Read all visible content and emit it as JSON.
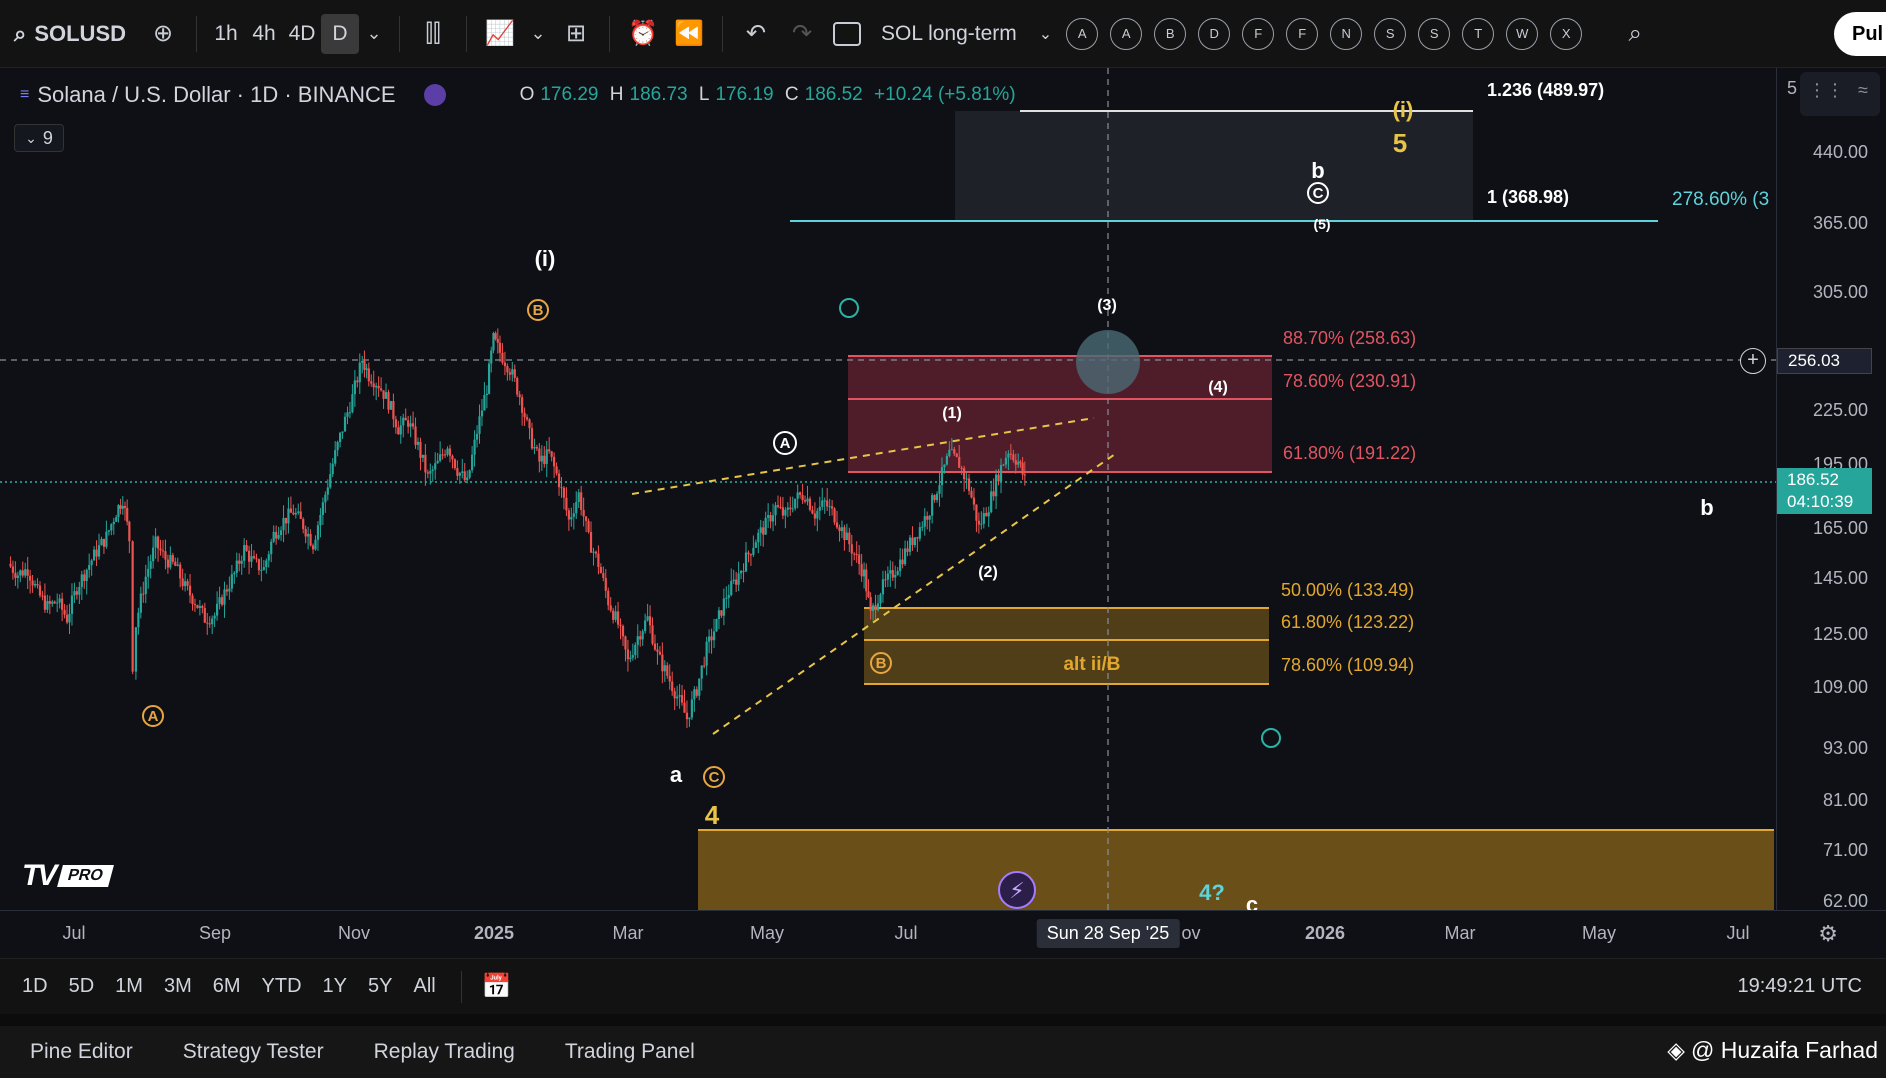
{
  "toolbar": {
    "symbol": "SOLUSD",
    "intervals": [
      "1h",
      "4h",
      "4D",
      "D"
    ],
    "active_interval": "D",
    "layout_name": "SOL long-term",
    "alert_circles": [
      "A",
      "A",
      "B",
      "D",
      "F",
      "F",
      "N",
      "S",
      "S",
      "T",
      "W",
      "X"
    ],
    "publish_label": "Pul"
  },
  "legend": {
    "title": "Solana / U.S. Dollar · 1D · BINANCE",
    "o_key": "O",
    "o_val": "176.29",
    "h_key": "H",
    "h_val": "186.73",
    "l_key": "L",
    "l_val": "176.19",
    "c_key": "C",
    "c_val": "186.52",
    "change": "+10.24 (+5.81%)",
    "collapsed_count": "9"
  },
  "price_axis": {
    "labels": [
      "440.00",
      "365.00",
      "305.00",
      "225.00",
      "195.00",
      "165.00",
      "145.00",
      "125.00",
      "109.00",
      "93.00",
      "81.00",
      "71.00",
      "62.00"
    ],
    "top_partial": "5",
    "crosshair_price": "256.03",
    "last_price": "186.52",
    "countdown": "04:10:39"
  },
  "time_axis": {
    "labels": [
      "Jul",
      "Sep",
      "Nov",
      "2025",
      "Mar",
      "May",
      "Jul",
      "ov",
      "2026",
      "Mar",
      "May",
      "Jul"
    ],
    "cursor_date": "Sun 28 Sep '25"
  },
  "fib_levels": {
    "upper": [
      {
        "label": "1.236 (489.97)"
      },
      {
        "label": "1 (368.98)"
      },
      {
        "label": "278.60% (3"
      }
    ],
    "resistance": [
      {
        "label": "88.70% (258.63)"
      },
      {
        "label": "78.60% (230.91)"
      },
      {
        "label": "61.80% (191.22)"
      }
    ],
    "support": [
      {
        "label": "50.00% (133.49)"
      },
      {
        "label": "61.80% (123.22)"
      },
      {
        "label": "78.60% (109.94)"
      }
    ],
    "alt_box_label": "alt ii/B"
  },
  "wave_labels": {
    "i_left": "(i)",
    "i_right": "(i)",
    "five": "5",
    "b_top": "b",
    "c_circle": "C",
    "five_paren": "(5)",
    "three": "(3)",
    "four_paren": "(4)",
    "one": "(1)",
    "two": "(2)",
    "a_circle": "A",
    "b_circle": "B",
    "b_circle_box": "B",
    "a_low": "A",
    "c_low": "C",
    "a_small": "a",
    "four": "4",
    "b_right": "b",
    "four_q": "4?",
    "c_bottom": "c"
  },
  "chart_data": {
    "type": "candlestick",
    "series": [
      {
        "name": "",
        "points": [
          [
            0,
            150
          ],
          [
            3,
            146
          ],
          [
            6,
            148
          ],
          [
            9,
            139
          ],
          [
            12,
            134
          ],
          [
            15,
            136
          ],
          [
            18,
            130
          ],
          [
            21,
            141
          ],
          [
            24,
            148
          ],
          [
            27,
            155
          ],
          [
            30,
            161
          ],
          [
            33,
            172
          ],
          [
            35,
            178
          ],
          [
            37,
            160
          ],
          [
            38,
            115
          ],
          [
            39,
            128
          ],
          [
            42,
            145
          ],
          [
            45,
            158
          ],
          [
            48,
            152
          ],
          [
            51,
            149
          ],
          [
            54,
            141
          ],
          [
            57,
            136
          ],
          [
            60,
            130
          ],
          [
            63,
            131
          ],
          [
            66,
            139
          ],
          [
            69,
            146
          ],
          [
            72,
            156
          ],
          [
            75,
            150
          ],
          [
            78,
            148
          ],
          [
            81,
            162
          ],
          [
            84,
            168
          ],
          [
            87,
            172
          ],
          [
            90,
            166
          ],
          [
            93,
            158
          ],
          [
            96,
            175
          ],
          [
            99,
            195
          ],
          [
            102,
            214
          ],
          [
            105,
            232
          ],
          [
            108,
            256
          ],
          [
            110,
            246
          ],
          [
            113,
            240
          ],
          [
            116,
            229
          ],
          [
            119,
            214
          ],
          [
            122,
            218
          ],
          [
            125,
            204
          ],
          [
            128,
            188
          ],
          [
            131,
            195
          ],
          [
            134,
            205
          ],
          [
            137,
            192
          ],
          [
            140,
            185
          ],
          [
            143,
            212
          ],
          [
            146,
            238
          ],
          [
            148,
            270
          ],
          [
            150,
            261
          ],
          [
            153,
            250
          ],
          [
            156,
            233
          ],
          [
            159,
            210
          ],
          [
            162,
            196
          ],
          [
            165,
            200
          ],
          [
            168,
            186
          ],
          [
            171,
            168
          ],
          [
            174,
            180
          ],
          [
            177,
            160
          ],
          [
            180,
            150
          ],
          [
            183,
            136
          ],
          [
            186,
            128
          ],
          [
            189,
            116
          ],
          [
            192,
            124
          ],
          [
            195,
            130
          ],
          [
            198,
            118
          ],
          [
            201,
            112
          ],
          [
            204,
            106
          ],
          [
            207,
            100
          ],
          [
            210,
            108
          ],
          [
            213,
            120
          ],
          [
            216,
            128
          ],
          [
            219,
            138
          ],
          [
            222,
            144
          ],
          [
            225,
            152
          ],
          [
            228,
            160
          ],
          [
            231,
            166
          ],
          [
            234,
            174
          ],
          [
            237,
            170
          ],
          [
            240,
            178
          ],
          [
            243,
            180
          ],
          [
            246,
            171
          ],
          [
            249,
            176
          ],
          [
            252,
            170
          ],
          [
            255,
            162
          ],
          [
            258,
            154
          ],
          [
            261,
            146
          ],
          [
            263,
            131
          ],
          [
            266,
            140
          ],
          [
            269,
            145
          ],
          [
            272,
            151
          ],
          [
            275,
            158
          ],
          [
            278,
            165
          ],
          [
            281,
            173
          ],
          [
            284,
            186
          ],
          [
            287,
            200
          ],
          [
            290,
            195
          ],
          [
            293,
            183
          ],
          [
            296,
            165
          ],
          [
            299,
            175
          ],
          [
            302,
            190
          ],
          [
            305,
            202
          ],
          [
            308,
            196
          ],
          [
            310,
            187
          ]
        ]
      }
    ]
  },
  "footer": {
    "ranges": [
      "1D",
      "5D",
      "1M",
      "3M",
      "6M",
      "YTD",
      "1Y",
      "5Y",
      "All"
    ],
    "clock": "19:49:21 UTC",
    "tabs": [
      "Pine Editor",
      "Strategy Tester",
      "Replay Trading",
      "Trading Panel"
    ],
    "watermark": "@ Huzaifa Farhad"
  }
}
